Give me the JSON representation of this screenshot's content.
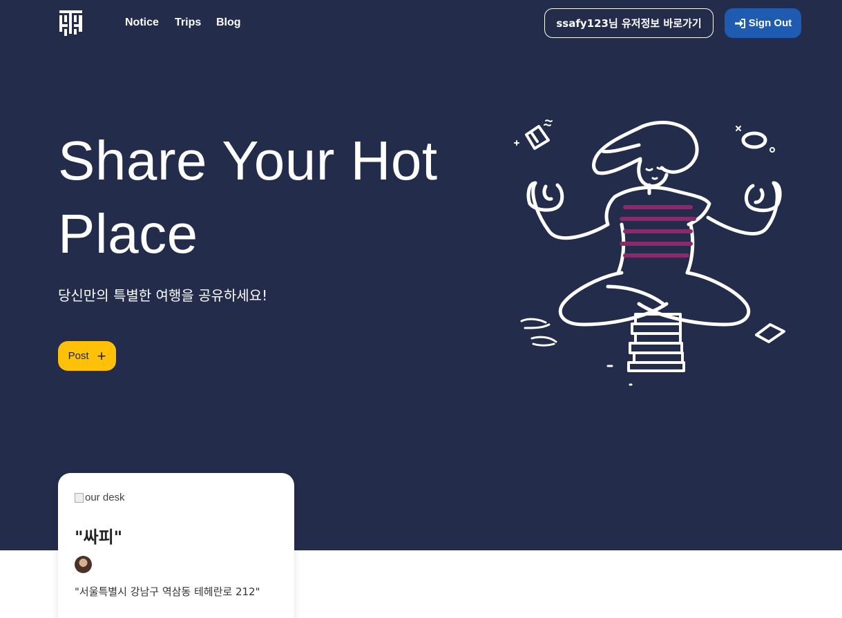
{
  "nav": {
    "links": [
      {
        "label": "Notice"
      },
      {
        "label": "Trips"
      },
      {
        "label": "Blog"
      }
    ],
    "user_button_label": "ssafy123님 유저정보 바로가기",
    "sign_out_label": "Sign Out",
    "sign_out_icon": "sign-in-arrow-icon",
    "sign_out_color": "#1f5bb0"
  },
  "hero": {
    "title": "Share Your Hot Place",
    "subtitle": "당신만의 특별한 여행을 공유하세요!",
    "post_button_label": "Post",
    "post_button_icon": "+",
    "background_color": "#242c4c",
    "accent_color": "#ffc107"
  },
  "card": {
    "image_alt": "our desk",
    "title": "\"싸피\"",
    "address": "\"서울특별시 강남구 역삼동 테헤란로 212\""
  }
}
